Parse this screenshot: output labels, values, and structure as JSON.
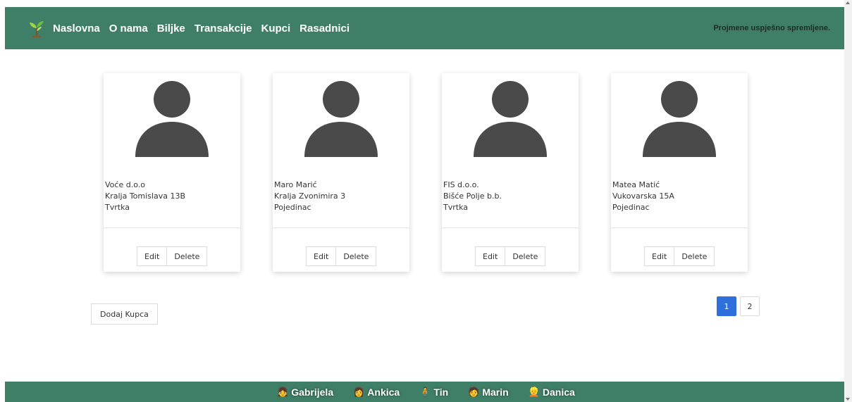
{
  "navbar": {
    "links": [
      "Naslovna",
      "O nama",
      "Biljke",
      "Transakcije",
      "Kupci",
      "Rasadnici"
    ],
    "status_message": "Projmene uspješno spremljene."
  },
  "customers": [
    {
      "name": "Voće d.o.o",
      "address": "Kralja Tomislava 13B",
      "type": "Tvrtka"
    },
    {
      "name": "Maro Marić",
      "address": "Kralja Zvonimira 3",
      "type": "Pojedinac"
    },
    {
      "name": "FIS d.o.o.",
      "address": "Bišće Polje b.b.",
      "type": "Tvrtka"
    },
    {
      "name": "Matea Matić",
      "address": "Vukovarska 15A",
      "type": "Pojedinac"
    }
  ],
  "card_actions": {
    "edit": "Edit",
    "delete": "Delete"
  },
  "add_button": "Dodaj Kupca",
  "pagination": {
    "pages": [
      "1",
      "2"
    ],
    "current": "1"
  },
  "footer": {
    "members": [
      {
        "emoji": "👧",
        "name": "Gabrijela"
      },
      {
        "emoji": "👩",
        "name": "Ankica"
      },
      {
        "emoji": "🧍",
        "name": "Tin"
      },
      {
        "emoji": "🧑",
        "name": "Marin"
      },
      {
        "emoji": "👱",
        "name": "Danica"
      }
    ]
  },
  "colors": {
    "nav_bg": "#3f7f67",
    "active_page": "#2f6fdc",
    "avatar": "#4a4a4a"
  }
}
